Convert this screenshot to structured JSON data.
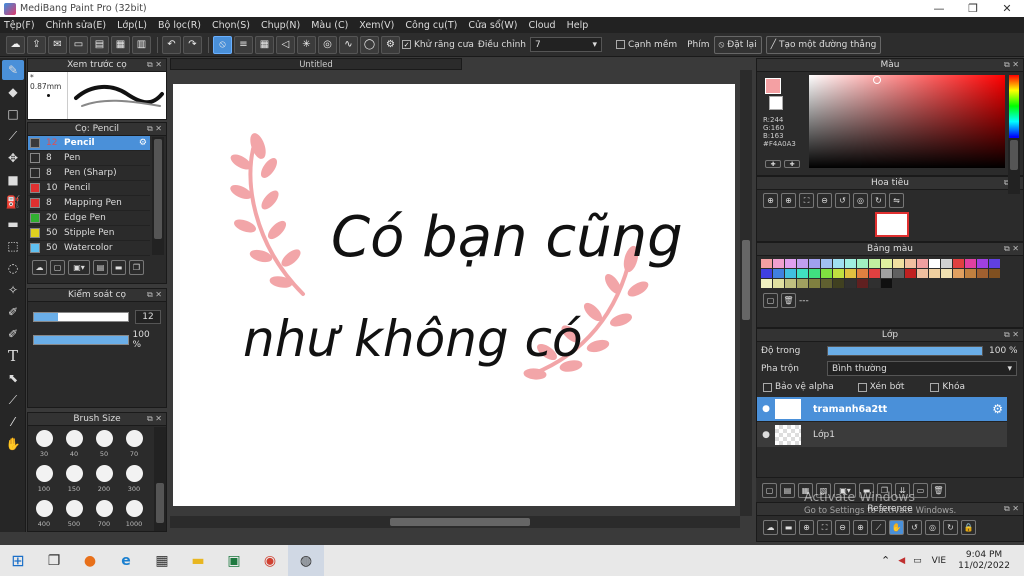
{
  "window": {
    "title": "MediBang Paint Pro (32bit)",
    "minimize": "—",
    "restore": "❐",
    "close": "✕"
  },
  "menu": [
    "Tệp(F)",
    "Chỉnh sửa(E)",
    "Lớp(L)",
    "Bộ lọc(R)",
    "Chọn(S)",
    "Chụp(N)",
    "Màu (C)",
    "Xem(V)",
    "Công cụ(T)",
    "Cửa sổ(W)",
    "Cloud",
    "Help"
  ],
  "toolbar": {
    "antialias_label": "Khử răng cưa",
    "correction_label": "Điều chỉnh",
    "correction_value": "7",
    "edge_label": "Cạnh mềm",
    "key_label": "Phím",
    "reset_label": "Đặt lại",
    "straight_label": "Tạo một đường thẳng"
  },
  "brush_preview": {
    "title": "Xem trước cọ",
    "size": "0.87mm"
  },
  "brush_panel": {
    "title": "Cọ: Pencil",
    "items": [
      {
        "size": "12",
        "name": "Pencil",
        "color": "#3a3a3a"
      },
      {
        "size": "8",
        "name": "Pen",
        "color": "#2a2a2a"
      },
      {
        "size": "8",
        "name": "Pen (Sharp)",
        "color": "#2a2a2a"
      },
      {
        "size": "10",
        "name": "Pencil",
        "color": "#e03030"
      },
      {
        "size": "8",
        "name": "Mapping Pen",
        "color": "#e03030"
      },
      {
        "size": "20",
        "name": "Edge Pen",
        "color": "#30b030"
      },
      {
        "size": "50",
        "name": "Stipple Pen",
        "color": "#e0d020"
      },
      {
        "size": "50",
        "name": "Watercolor",
        "color": "#60c0f0"
      }
    ]
  },
  "brush_control": {
    "title": "Kiểm soát cọ",
    "size_value": "12",
    "size_fraction": 0.25,
    "opacity_value": "100 %",
    "opacity_fraction": 1.0
  },
  "brush_size": {
    "title": "Brush Size",
    "sizes": [
      "30",
      "40",
      "50",
      "70",
      "100",
      "150",
      "200",
      "300",
      "400",
      "500",
      "700",
      "1000"
    ]
  },
  "canvas": {
    "doc_tab": "Untitled",
    "text_line1": "Có bạn cũng",
    "text_line2": "như không có"
  },
  "color_panel": {
    "title": "Màu",
    "r": "R:244",
    "g": "G:160",
    "b": "B:163",
    "hex": "#F4A0A3",
    "fg": "#f4a0a3"
  },
  "navigator": {
    "title": "Hoa tiêu"
  },
  "palette": {
    "title": "Bảng màu",
    "dash": "---",
    "colors": [
      "#f4a0a3",
      "#f0a0d0",
      "#e0a0f0",
      "#c0a0f0",
      "#a0a0f0",
      "#a0c0f0",
      "#a0e0f0",
      "#a0f0e0",
      "#a0f0c0",
      "#c0f0a0",
      "#e0f0a0",
      "#f0e0a0",
      "#f0c0a0",
      "#f0a0a0",
      "#ffffff",
      "#d0d0d0",
      "#e04040",
      "#e040a0",
      "#a040e0",
      "#6040e0",
      "#4040e0",
      "#4080e0",
      "#40c0e0",
      "#40e0c0",
      "#40e080",
      "#80e040",
      "#c0e040",
      "#e0c040",
      "#e08040",
      "#e04040",
      "#a0a0a0",
      "#606060",
      "#c02020",
      "#f0c0a0",
      "#f0d0a0",
      "#f0e0b0",
      "#e0a060",
      "#c08040",
      "#a06030",
      "#805020",
      "#f0f0c0",
      "#e0e0a0",
      "#c0c080",
      "#a0a060",
      "#808040",
      "#606030",
      "#404020",
      "#303030",
      "#602020",
      "#303030",
      "#101010"
    ]
  },
  "layers": {
    "title": "Lớp",
    "opacity_label": "Độ trong",
    "opacity_value": "100 %",
    "opacity_fraction": 1.0,
    "blend_label": "Pha trộn",
    "blend_value": "Bình thường",
    "protect_alpha": "Bảo vệ alpha",
    "clipping": "Xén bớt",
    "lock": "Khóa",
    "items": [
      {
        "name": "tramanh6a2tt"
      },
      {
        "name": "Lớp1"
      }
    ]
  },
  "reference": {
    "title": "Reference"
  },
  "watermark": {
    "line1": "Activate Windows",
    "line2": "Go to Settings to activate Windows."
  },
  "taskbar": {
    "lang": "VIE",
    "time": "9:04 PM",
    "date": "11/02/2022"
  }
}
